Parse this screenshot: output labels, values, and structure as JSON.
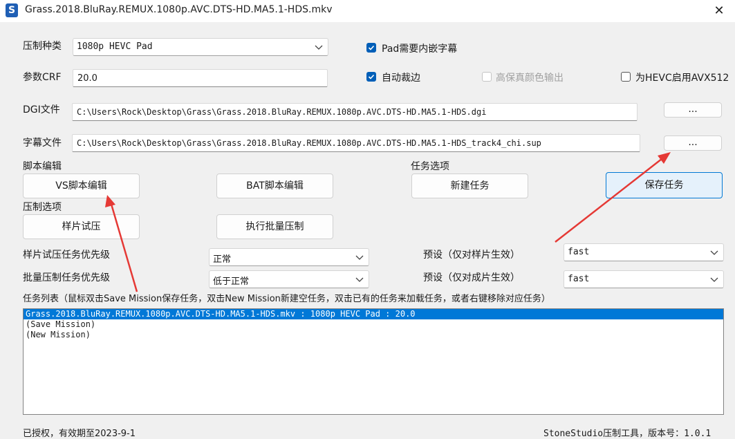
{
  "window": {
    "title": "Grass.2018.BluRay.REMUX.1080p.AVC.DTS-HD.MA5.1-HDS.mkv",
    "app_icon": "S",
    "close_glyph": "✕"
  },
  "form": {
    "preset_type_label": "压制种类",
    "preset_type_value": "1080p HEVC Pad",
    "crf_label": "参数CRF",
    "crf_value": "20.0",
    "dgi_label": "DGI文件",
    "dgi_value": "C:\\Users\\Rock\\Desktop\\Grass\\Grass.2018.BluRay.REMUX.1080p.AVC.DTS-HD.MA5.1-HDS.dgi",
    "dgi_browse": "...",
    "subtitle_label": "字幕文件",
    "subtitle_value": "C:\\Users\\Rock\\Desktop\\Grass\\Grass.2018.BluRay.REMUX.1080p.AVC.DTS-HD.MA5.1-HDS_track4_chi.sup",
    "subtitle_browse": "..."
  },
  "checkboxes": {
    "pad_embed_subs": {
      "label": "Pad需要内嵌字幕",
      "checked": true
    },
    "auto_crop": {
      "label": "自动裁边",
      "checked": true
    },
    "high_fidelity_color": {
      "label": "高保真颜色输出",
      "checked": false,
      "disabled": true
    },
    "hevc_avx512": {
      "label": "为HEVC启用AVX512",
      "checked": false
    }
  },
  "sections": {
    "script_edit": "脚本编辑",
    "task_options": "任务选项",
    "encode_options": "压制选项"
  },
  "buttons": {
    "vs_script": "VS脚本编辑",
    "bat_script": "BAT脚本编辑",
    "new_task": "新建任务",
    "save_task": "保存任务",
    "sample_encode": "样片试压",
    "batch_encode": "执行批量压制"
  },
  "priority": {
    "sample_label": "样片试压任务优先级",
    "sample_value": "正常",
    "batch_label": "批量压制任务优先级",
    "batch_value": "低于正常",
    "sample_preset_label": "预设（仅对样片生效）",
    "sample_preset_value": "fast",
    "final_preset_label": "预设（仅对成片生效）",
    "final_preset_value": "fast"
  },
  "task_list": {
    "label": "任务列表（鼠标双击Save Mission保存任务，双击New Mission新建空任务，双击已有的任务来加载任务，或者右键移除对应任务）",
    "items": [
      {
        "text": "Grass.2018.BluRay.REMUX.1080p.AVC.DTS-HD.MA5.1-HDS.mkv : 1080p HEVC Pad : 20.0",
        "selected": true
      },
      {
        "text": "(Save Mission)",
        "selected": false
      },
      {
        "text": "(New Mission)",
        "selected": false
      }
    ]
  },
  "status": {
    "license": "已授权，有效期至2023-9-1",
    "version": "StoneStudio压制工具，版本号：1.0.1"
  },
  "colors": {
    "accent": "#005fb8",
    "selection": "#0078d7",
    "annotation_arrow": "#e53935"
  }
}
